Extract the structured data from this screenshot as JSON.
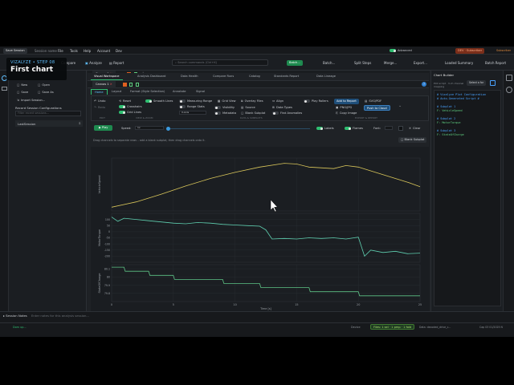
{
  "overlay": {
    "brand": "VIZALYZE",
    "dot": "•",
    "step": "STEP 08",
    "title": "First chart"
  },
  "titlebar": {
    "save_session": "Save Session",
    "session_name": "Session name",
    "menus": [
      "File",
      "Tools",
      "Help",
      "Account",
      "Dev"
    ],
    "advanced_label": "Advanced",
    "user_badge": "DEV · Subscriber",
    "plan_badge": "Subscriber"
  },
  "toolbar": {
    "compare": "Compare",
    "analyze": "Analyze",
    "report": "Report",
    "search_placeholder": "Search commands (Ctrl+K)",
    "buttons": [
      "Batch...",
      "Batch...",
      "Split Steps",
      "Merge...",
      "Export...",
      "Loaded Summary",
      "Batch Report"
    ]
  },
  "left_panel": {
    "new": "New",
    "open": "Open",
    "save": "Save",
    "save_as": "Save As",
    "import": "Import Session...",
    "record_title": "Record Session Configurations",
    "search_placeholder": "Filter recent sessions...",
    "last_session": "LastSession"
  },
  "workspace": {
    "doc_tab": "Canvas 1",
    "tabs": [
      "Visual Workspace",
      "Analysis Dashboard",
      "Data Health",
      "Compare Runs",
      "Catalog",
      "Standards Report",
      "Data Lineage"
    ],
    "ribbon_tabs": [
      "Home",
      "Layout",
      "Format (Style Selection)",
      "Annotate",
      "Signal"
    ],
    "ribbon": {
      "g1": [
        "Undo",
        "Redo"
      ],
      "g1_footer": "EDIT",
      "g2": [
        "Reset",
        "Crosshairs",
        "Grid Lines"
      ],
      "g2_footer": "VIEW & ZOOM",
      "g3": [
        "Smooth Lines",
        "Measuring Range",
        "Range Stats",
        "Visibility",
        "Metadata"
      ],
      "g3_select": "X-Axis",
      "g4": [
        "Grid View",
        "Source",
        "Blank Subplot"
      ],
      "g4_footer": "DATA & SUBPLOTS",
      "g5": [
        "Overlay Files",
        "Align",
        "Data Types",
        "Find Anomalies"
      ],
      "g6": [
        "Play Rollers"
      ],
      "g7": [
        "Add to Report",
        "PNG/JPG",
        "Copy Image",
        "SVG/PDF",
        "Push to Cloud"
      ],
      "g7_footer": "EXPORT & REPORT"
    },
    "playback": {
      "play": "Play",
      "speed_label": "Speed:",
      "speed_value": "1x",
      "labels": "Labels",
      "flames": "Flames",
      "font_label": "Font:",
      "font_value": "",
      "clear": "Clear"
    },
    "hint": "Drag channels to separate rows – add a blank subplot, then drag channels onto it.",
    "blank_subplot": "Blank Subplot"
  },
  "right_panel": {
    "title": "Chart Builder",
    "plot_script": "Plot script · 3-ch channel mapping",
    "select_button": "Select a for",
    "code": [
      "# Vizalyze Plot Configuration",
      "# Auto-Generated Script #",
      "",
      "# Subplot 1",
      "F: VehicleSpeed",
      "",
      "# Subplot 2",
      "F: MotorTorque",
      "",
      "# Subplot 3",
      "F: StateOfCharge"
    ]
  },
  "bottom": {
    "session_notes": "Session Notes",
    "notes_placeholder": "Enter notes for this analysis session...",
    "log": "Dom up...",
    "device_label": "Device",
    "files_badge": "Files: 1 sel · 1 pmp · 1 fold",
    "path": "Data: decoded_drive_c... ",
    "count": "Cap 03 01/2025 N"
  },
  "chart_data": [
    {
      "type": "line",
      "ylabel": "VehicleSpeed",
      "ylim": [
        0,
        70
      ],
      "yticks": [],
      "color": "#d9c65a",
      "x": [
        0,
        2,
        4,
        6,
        8,
        10,
        12,
        14,
        15,
        16,
        18,
        19,
        20,
        22,
        24,
        25
      ],
      "y": [
        5,
        12,
        22,
        33,
        43,
        51,
        58,
        63,
        62,
        58,
        56,
        60,
        58,
        48,
        38,
        32
      ]
    },
    {
      "type": "line",
      "ylabel": "MotorTorque",
      "ylim": [
        -250,
        150
      ],
      "yticks": [
        100,
        50,
        0,
        -50,
        -100,
        -150,
        -200
      ],
      "color": "#5fcfb0",
      "x": [
        0,
        0.5,
        1,
        2,
        3,
        4,
        5,
        6,
        7,
        8,
        9,
        10,
        11,
        12,
        12.5,
        13,
        14,
        15,
        16,
        17,
        18,
        19,
        20,
        20.5,
        21,
        22,
        23,
        24,
        25
      ],
      "y": [
        120,
        85,
        110,
        100,
        90,
        80,
        70,
        65,
        75,
        70,
        60,
        55,
        50,
        45,
        15,
        -60,
        -55,
        -60,
        -50,
        -55,
        -50,
        -60,
        -45,
        -200,
        -150,
        -170,
        -160,
        -180,
        -175
      ]
    },
    {
      "type": "line",
      "ylabel": "StateOfCharge",
      "ylim": [
        79.7,
        80.15
      ],
      "yticks": [
        80.1,
        80.0,
        79.9,
        79.8
      ],
      "color": "#5ec486",
      "x": [
        0,
        1,
        1.1,
        3,
        3.1,
        5,
        5.1,
        9,
        9.1,
        12,
        12.1,
        16,
        16.1,
        20,
        20.1,
        25
      ],
      "y": [
        80.12,
        80.12,
        80.07,
        80.07,
        80.02,
        80.02,
        79.97,
        79.97,
        79.92,
        79.92,
        79.87,
        79.87,
        79.82,
        79.82,
        79.77,
        79.77
      ]
    }
  ],
  "xaxis": {
    "ticks": [
      0,
      5,
      10,
      15,
      20,
      25
    ],
    "label": "Time [s]",
    "xlim": [
      0,
      25
    ]
  },
  "colors": {
    "accent": "#2fbf71",
    "primary_btn": "#1e8a4f",
    "bg": "#1d2024",
    "link": "#4aa3ff"
  }
}
